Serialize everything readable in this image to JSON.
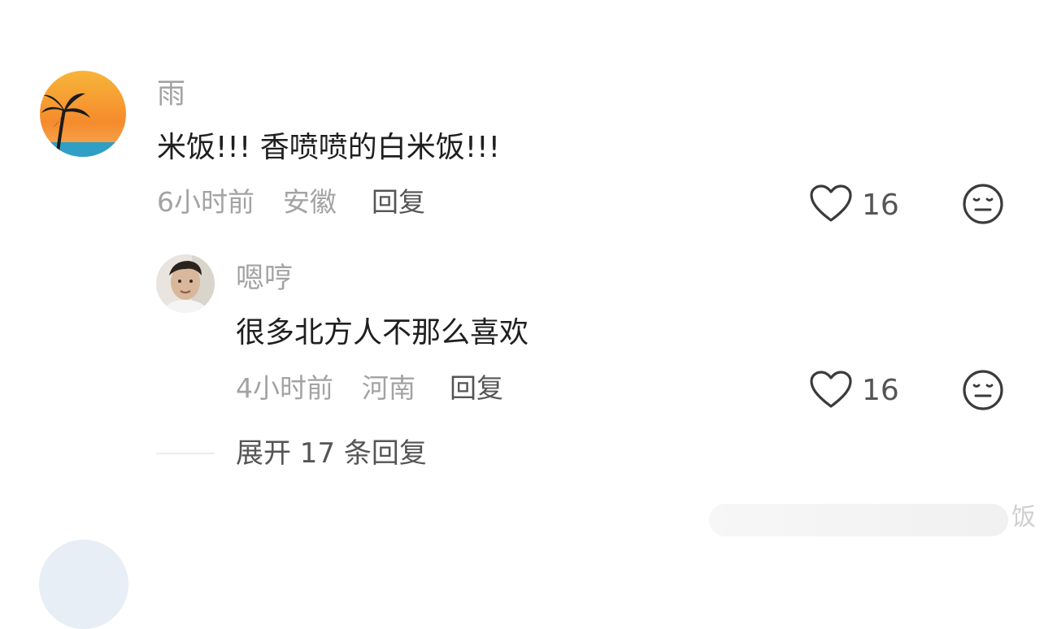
{
  "comments": [
    {
      "username": "雨",
      "text": "米饭!!! 香喷喷的白米饭!!!",
      "time": "6小时前",
      "location": "安徽",
      "reply_label": "回复",
      "likes": "16",
      "avatar_icon": "sunset-palm-avatar"
    }
  ],
  "replies": [
    {
      "username": "嗯哼",
      "text": "很多北方人不那么喜欢",
      "time": "4小时前",
      "location": "河南",
      "reply_label": "回复",
      "likes": "16",
      "avatar_icon": "person-photo-avatar"
    }
  ],
  "expand_label": "展开 17 条回复",
  "watermark_text": "饭",
  "icons": {
    "like": "heart-outline-icon",
    "reaction": "neutral-face-icon"
  },
  "colors": {
    "primary_text": "#1f1f1f",
    "secondary_text": "#a3a3a3",
    "action_text": "#555555"
  }
}
